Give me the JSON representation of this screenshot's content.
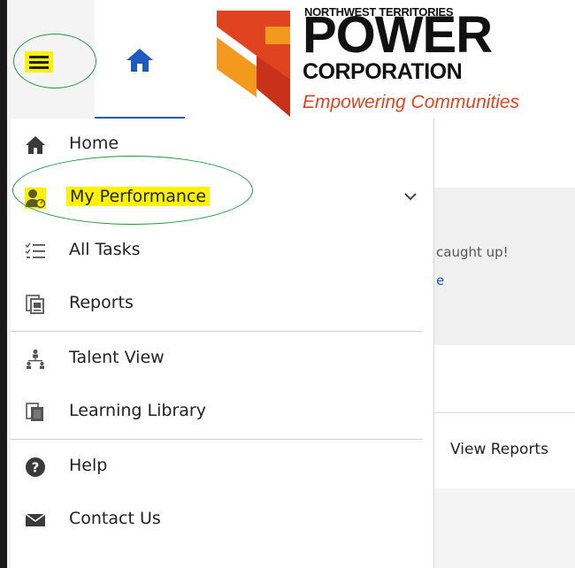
{
  "header": {
    "menu_button": "menu",
    "home_tab_icon": "home-icon",
    "logo": {
      "line1": "NORTHWEST TERRITORIES",
      "line2": "POWER",
      "line3": "CORPORATION",
      "tagline": "Empowering Communities"
    }
  },
  "menu": {
    "items": [
      {
        "label": "Home",
        "icon": "home-icon"
      },
      {
        "label": "My Performance",
        "icon": "performance-icon"
      },
      {
        "label": "All Tasks",
        "icon": "tasks-icon"
      },
      {
        "label": "Reports",
        "icon": "reports-icon"
      },
      {
        "label": "Talent View",
        "icon": "talent-icon"
      },
      {
        "label": "Learning Library",
        "icon": "library-icon"
      },
      {
        "label": "Help",
        "icon": "help-icon"
      },
      {
        "label": "Contact Us",
        "icon": "mail-icon"
      }
    ]
  },
  "background": {
    "caught_up_text": "caught up!",
    "link_text": "e",
    "view_reports": "View Reports"
  },
  "colors": {
    "highlight": "#fff200",
    "accent": "#1f5bbf",
    "annotation": "#1f9a3a",
    "logo_orange": "#e0431f"
  }
}
